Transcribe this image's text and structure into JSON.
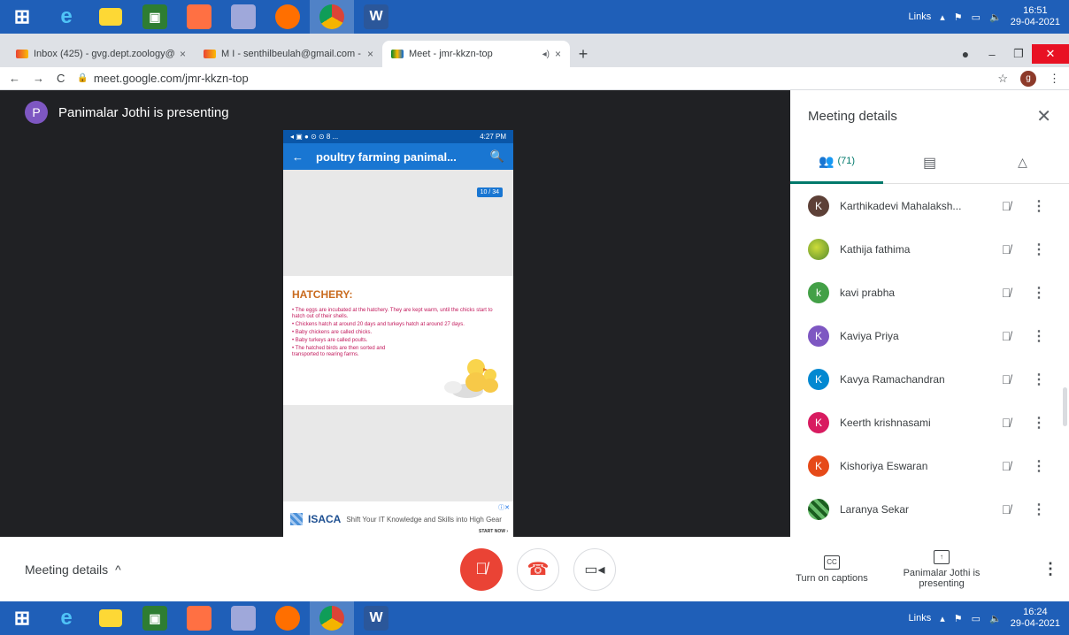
{
  "taskbar_top": {
    "apps": [
      "windows-start-icon",
      "internet-explorer-icon",
      "file-explorer-icon",
      "store-icon",
      "paint-icon",
      "word-pad-icon",
      "firefox-icon",
      "chrome-icon",
      "word-icon"
    ],
    "tray_label": "Links",
    "time": "16:51",
    "date": "29-04-2021"
  },
  "taskbar_bottom": {
    "tray_label": "Links",
    "time": "16:24",
    "date": "29-04-2021"
  },
  "tabs": [
    {
      "title": "Inbox (425) - gvg.dept.zoology@",
      "close": "×"
    },
    {
      "title": "M I - senthilbeulah@gmail.com -",
      "close": "×"
    },
    {
      "title": "Meet - jmr-kkzn-top",
      "close": "×"
    }
  ],
  "newtab_label": "+",
  "address": {
    "url": "meet.google.com/jmr-kkzn-top",
    "profile": "g"
  },
  "presenter": {
    "initial": "P",
    "text": "Panimalar Jothi is presenting"
  },
  "phone": {
    "status_left": "◂ ▣ ● ⊙ ⊙ 8 ...",
    "status_right": "4:27 PM",
    "app_title": "poultry farming panimal...",
    "page_badge": "10 / 34",
    "slide_heading": "HATCHERY:",
    "slide_bullets": [
      "• The eggs are incubated at the hatchery. They are kept warm, until the chicks start to hatch out of their shells.",
      "• Chickens hatch at around 20 days and turkeys hatch at around 27 days.",
      "• Baby chickens are called chicks.",
      "• Baby turkeys are called poults.",
      "• The hatched birds are then sorted and transported to rearing farms."
    ],
    "ad_brand": "ISACA",
    "ad_text": "Shift Your IT Knowledge and Skills into High Gear",
    "ad_cta": "START NOW ›"
  },
  "panel": {
    "title": "Meeting details",
    "people_count": "(71)",
    "participants": [
      {
        "initial": "K",
        "name": "Karthikadevi Mahalaksh...",
        "color": "#5d4037"
      },
      {
        "initial": "",
        "name": "Kathija fathima",
        "color": "#7cb342"
      },
      {
        "initial": "k",
        "name": "kavi prabha",
        "color": "#43a047"
      },
      {
        "initial": "K",
        "name": "Kaviya Priya",
        "color": "#7e57c2"
      },
      {
        "initial": "K",
        "name": "Kavya Ramachandran",
        "color": "#0288d1"
      },
      {
        "initial": "K",
        "name": "Keerth krishnasami",
        "color": "#d81b60"
      },
      {
        "initial": "K",
        "name": "Kishoriya Eswaran",
        "color": "#e64a19"
      },
      {
        "initial": "",
        "name": "Laranya Sekar",
        "color": "#2e7d32"
      }
    ]
  },
  "controls": {
    "meeting_details": "Meeting details",
    "captions": "Turn on captions",
    "presenting": "Panimalar Jothi is presenting"
  }
}
